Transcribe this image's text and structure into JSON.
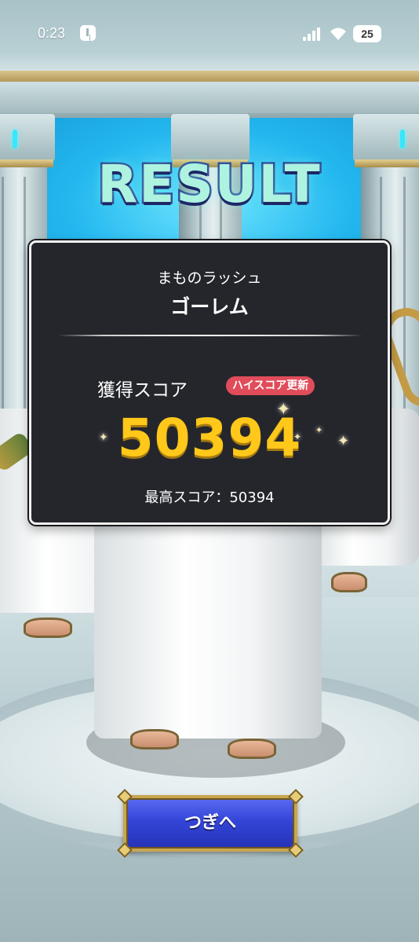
{
  "status_bar": {
    "time": "0:23",
    "battery": "25",
    "icons": [
      "notification-icon",
      "signal-icon",
      "wifi-icon",
      "battery-icon"
    ]
  },
  "title": "RESULT",
  "result_panel": {
    "mode": "まものラッシュ",
    "boss": "ゴーレム",
    "score_label": "獲得スコア",
    "highscore_badge": "ハイスコア更新",
    "score": "50394",
    "best_score": "最高スコア：50394"
  },
  "next_button": {
    "label": "つぎへ"
  },
  "colors": {
    "panel_bg": "#25262c",
    "score": "#ffc81a",
    "badge": "#e14c5a",
    "button": "#3345d8",
    "button_border": "#c9a64f"
  }
}
